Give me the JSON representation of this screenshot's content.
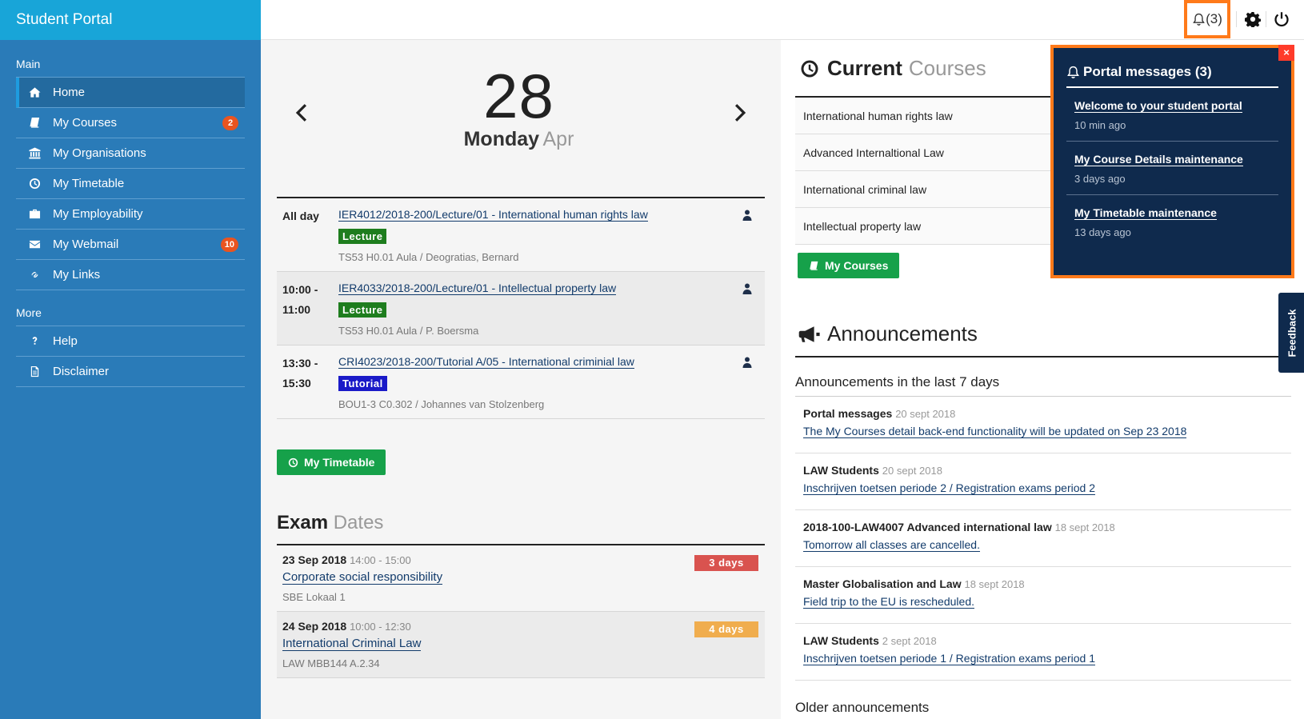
{
  "app": {
    "title": "Student Portal"
  },
  "sidebar": {
    "main_label": "Main",
    "more_label": "More",
    "main_items": [
      {
        "label": "Home",
        "icon": "home-icon",
        "active": true
      },
      {
        "label": "My Courses",
        "icon": "book-icon",
        "badge": "2"
      },
      {
        "label": "My Organisations",
        "icon": "institution-icon"
      },
      {
        "label": "My Timetable",
        "icon": "clock-icon"
      },
      {
        "label": "My Employability",
        "icon": "briefcase-icon"
      },
      {
        "label": "My Webmail",
        "icon": "envelope-icon",
        "badge": "10"
      },
      {
        "label": "My Links",
        "icon": "link-icon"
      }
    ],
    "more_items": [
      {
        "label": "Help",
        "icon": "question-icon"
      },
      {
        "label": "Disclaimer",
        "icon": "document-icon"
      }
    ]
  },
  "topbar": {
    "notifications_label": "(3)"
  },
  "calendar": {
    "day_number": "28",
    "weekday": "Monday",
    "month": "Apr",
    "events": [
      {
        "time": "All day",
        "title": "IER4012/2018-200/Lecture/01 - International human rights law",
        "tag": "Lecture",
        "location": "TS53 H0.01 Aula / Deogratias, Bernard"
      },
      {
        "time": "10:00 - 11:00",
        "title": "IER4033/2018-200/Lecture/01 - Intellectual property law",
        "tag": "Lecture",
        "location": "TS53 H0.01 Aula / P. Boersma"
      },
      {
        "time": "13:30 - 15:30",
        "title": "CRI4023/2018-200/Tutorial A/05 - International criminial law",
        "tag": "Tutorial",
        "location": "BOU1-3 C0.302 / Johannes van Stolzenberg"
      }
    ],
    "button_label": "My Timetable"
  },
  "exams": {
    "title_bold": "Exam",
    "title_light": "Dates",
    "items": [
      {
        "date": "23 Sep 2018",
        "time": "14:00 - 15:00",
        "course": "Corporate social responsibility",
        "location": "SBE Lokaal 1",
        "countdown": "3 days",
        "color": "#d9534f"
      },
      {
        "date": "24 Sep 2018",
        "time": "10:00 - 12:30",
        "course": "International Criminal Law",
        "location": "LAW MBB144 A.2.34",
        "countdown": "4 days",
        "color": "#f0ad4e"
      }
    ]
  },
  "courses": {
    "title_bold": "Current",
    "title_light": "Courses",
    "items": [
      "International human rights law",
      "Advanced Internaltional Law",
      "International criminal law",
      "Intellectual property law"
    ],
    "button_label": "My Courses"
  },
  "announcements": {
    "title": "Announcements",
    "subtitle": "Announcements in the last 7 days",
    "items": [
      {
        "source": "Portal messages",
        "date": "20 sept 2018",
        "text": "The My Courses detail back-end functionality will be updated on Sep 23 2018"
      },
      {
        "source": "LAW Students",
        "date": "20 sept 2018",
        "text": "Inschrijven toetsen periode 2 / Registration exams period 2"
      },
      {
        "source": "2018-100-LAW4007 Advanced international law",
        "date": "18 sept 2018",
        "text": "Tomorrow all classes are cancelled."
      },
      {
        "source": "Master Globalisation and Law",
        "date": "18 sept 2018",
        "text": "Field trip to the EU is rescheduled."
      },
      {
        "source": "LAW Students",
        "date": "2 sept 2018",
        "text": "Inschrijven toetsen periode 1 / Registration exams period 1"
      }
    ],
    "older_label": "Older announcements"
  },
  "messages": {
    "title": "Portal messages (3)",
    "close": "×",
    "items": [
      {
        "title": "Welcome to your student portal",
        "time": "10 min ago"
      },
      {
        "title": "My Course Details maintenance",
        "time": "3 days ago"
      },
      {
        "title": "My Timetable maintenance",
        "time": "13 days ago"
      }
    ]
  },
  "feedback": {
    "label": "Feedback"
  },
  "colors": {
    "sidebar": "#2a7bb8",
    "brand": "#18a5d8",
    "accent_orange": "#ff7a1a",
    "green": "#16a14a",
    "navy": "#0f2a4d"
  }
}
